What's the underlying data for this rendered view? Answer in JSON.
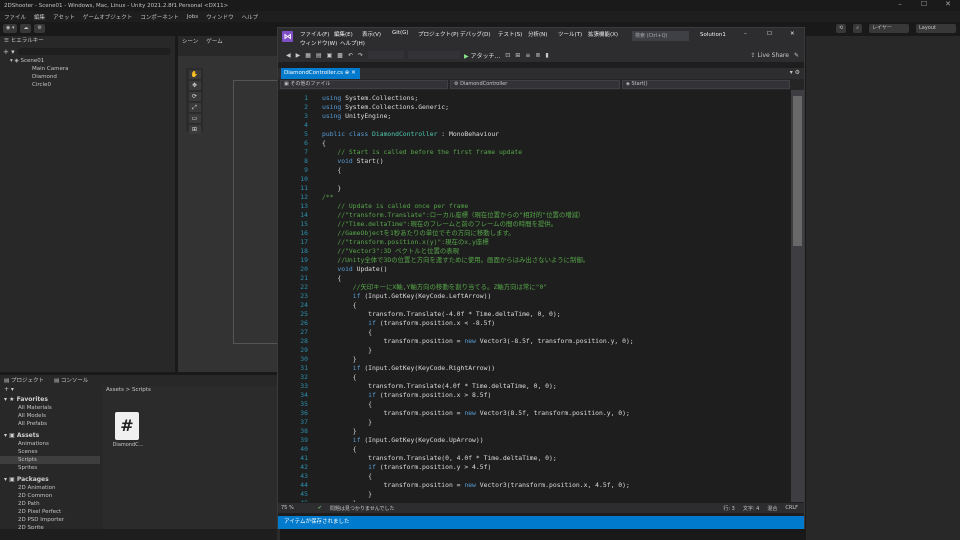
{
  "unity": {
    "title": "2DShooter - Scene01 - Windows, Mac, Linux - Unity 2021.2.8f1 Personal <DX11>",
    "menu": [
      "ファイル",
      "編集",
      "アセット",
      "ゲームオブジェクト",
      "コンポーネント",
      "Jobs",
      "ウィンドウ",
      "ヘルプ"
    ],
    "toolbar_right": [
      "レイヤー",
      "Layout"
    ],
    "hierarchy": {
      "tab": "ヒエラルキー",
      "scene": "Scene01",
      "objects": [
        "Main Camera",
        "Diamond",
        "Circle0"
      ]
    },
    "scene_tabs": [
      "シーン",
      "ゲーム"
    ],
    "project": {
      "tabs": [
        "プロジェクト",
        "コンソール"
      ],
      "favorites_title": "Favorites",
      "favorites": [
        "All Materials",
        "All Models",
        "All Prefabs"
      ],
      "assets_title": "Assets",
      "assets": [
        "Animations",
        "Scenes",
        "Scripts",
        "Sprites"
      ],
      "packages_title": "Packages",
      "packages": [
        "2D Animation",
        "2D Common",
        "2D Path",
        "2D Pixel Perfect",
        "2D PSD Importer",
        "2D Sprite"
      ],
      "breadcrumb": "Assets > Scripts",
      "file_label": "DiamondC..."
    },
    "status_message": "アイテムが保存されました"
  },
  "vs": {
    "menu": [
      "ファイル(F)",
      "編集(E)",
      "表示(V)",
      "Git(G)",
      "プロジェクト(P)",
      "デバッグ(D)",
      "テスト(S)",
      "分析(N)",
      "ツール(T)",
      "拡張機能(X)",
      "ウィンドウ(W)",
      "ヘルプ(H)"
    ],
    "search_placeholder": "検索 (Ctrl+Q)",
    "solution": "Solution1",
    "attach_label": "アタッチ...",
    "live_share": "Live Share",
    "tab_label": "DiamondController.cs",
    "nav": [
      "その他のファイル",
      "DiamondController",
      "Start()"
    ],
    "zoom": "75 %",
    "issues": "問題は見つかりませんでした",
    "line_info": "行: 3",
    "char_info": "文字: 4",
    "mode": "混合",
    "eol": "CRLF",
    "status": "アイテムが保存されました"
  },
  "code_lines": [
    {
      "n": "1",
      "t": [
        [
          "kw",
          "using "
        ],
        [
          "pl",
          "System.Collections;"
        ]
      ]
    },
    {
      "n": "2",
      "t": [
        [
          "kw",
          "using "
        ],
        [
          "pl",
          "System.Collections.Generic;"
        ]
      ]
    },
    {
      "n": "3",
      "t": [
        [
          "kw",
          "using "
        ],
        [
          "pl",
          "UnityEngine;"
        ]
      ]
    },
    {
      "n": "4",
      "t": []
    },
    {
      "n": "5",
      "t": [
        [
          "kw",
          "public class "
        ],
        [
          "ty",
          "DiamondController"
        ],
        [
          "pl",
          " : MonoBehaviour"
        ]
      ]
    },
    {
      "n": "6",
      "t": [
        [
          "pl",
          "{"
        ]
      ]
    },
    {
      "n": "7",
      "t": [
        [
          "cm",
          "    // Start is called before the first frame update"
        ]
      ]
    },
    {
      "n": "8",
      "t": [
        [
          "kw",
          "    void "
        ],
        [
          "pl",
          "Start()"
        ]
      ]
    },
    {
      "n": "9",
      "t": [
        [
          "pl",
          "    {"
        ]
      ]
    },
    {
      "n": "10",
      "t": []
    },
    {
      "n": "11",
      "t": [
        [
          "pl",
          "    }"
        ]
      ]
    },
    {
      "n": "12",
      "t": [
        [
          "cm",
          "/**"
        ]
      ]
    },
    {
      "n": "13",
      "t": [
        [
          "cm",
          "    // Update is called once per frame"
        ]
      ]
    },
    {
      "n": "14",
      "t": [
        [
          "cm",
          "    //\"transform.Translate\":ローカル座標（現在位置からの\"相対的\"位置の増減）"
        ]
      ]
    },
    {
      "n": "15",
      "t": [
        [
          "cm",
          "    //\"Time.deltaTime\":現在のフレームと前のフレームの間の時間を提供。"
        ]
      ]
    },
    {
      "n": "16",
      "t": [
        [
          "cm",
          "    //GameObjectを1秒あたりの単位でその方向に移動します。"
        ]
      ]
    },
    {
      "n": "17",
      "t": [
        [
          "cm",
          "    //\"transform.position.x(y)\":現在のx,y座標"
        ]
      ]
    },
    {
      "n": "18",
      "t": [
        [
          "cm",
          "    //\"Vector3\":3D ベクトルと位置の表現"
        ]
      ]
    },
    {
      "n": "19",
      "t": [
        [
          "cm",
          "    //Unity全体で3Dの位置と方向を渡すために使用。画面からはみ出さないように制御。"
        ]
      ]
    },
    {
      "n": "20",
      "t": [
        [
          "kw",
          "    void "
        ],
        [
          "pl",
          "Update()"
        ]
      ]
    },
    {
      "n": "21",
      "t": [
        [
          "pl",
          "    {"
        ]
      ]
    },
    {
      "n": "22",
      "t": [
        [
          "cm",
          "        //矢印キーにX軸,Y軸方向の移動を割り当てる。Z軸方向は常に\"0\""
        ]
      ]
    },
    {
      "n": "23",
      "t": [
        [
          "kw",
          "        if "
        ],
        [
          "pl",
          "(Input.GetKey(KeyCode.LeftArrow))"
        ]
      ]
    },
    {
      "n": "24",
      "t": [
        [
          "pl",
          "        {"
        ]
      ]
    },
    {
      "n": "25",
      "t": [
        [
          "pl",
          "            transform.Translate(-4.0f * Time.deltaTime, 0, 0);"
        ]
      ]
    },
    {
      "n": "26",
      "t": [
        [
          "kw",
          "            if "
        ],
        [
          "pl",
          "(transform.position.x < -8.5f)"
        ]
      ]
    },
    {
      "n": "27",
      "t": [
        [
          "pl",
          "            {"
        ]
      ]
    },
    {
      "n": "28",
      "t": [
        [
          "pl",
          "                transform.position = "
        ],
        [
          "kw",
          "new "
        ],
        [
          "pl",
          "Vector3(-8.5f, transform.position.y, 0);"
        ]
      ]
    },
    {
      "n": "29",
      "t": [
        [
          "pl",
          "            }"
        ]
      ]
    },
    {
      "n": "30",
      "t": [
        [
          "pl",
          "        }"
        ]
      ]
    },
    {
      "n": "31",
      "t": [
        [
          "kw",
          "        if "
        ],
        [
          "pl",
          "(Input.GetKey(KeyCode.RightArrow))"
        ]
      ]
    },
    {
      "n": "32",
      "t": [
        [
          "pl",
          "        {"
        ]
      ]
    },
    {
      "n": "33",
      "t": [
        [
          "pl",
          "            transform.Translate(4.0f * Time.deltaTime, 0, 0);"
        ]
      ]
    },
    {
      "n": "34",
      "t": [
        [
          "kw",
          "            if "
        ],
        [
          "pl",
          "(transform.position.x > 8.5f)"
        ]
      ]
    },
    {
      "n": "35",
      "t": [
        [
          "pl",
          "            {"
        ]
      ]
    },
    {
      "n": "36",
      "t": [
        [
          "pl",
          "                transform.position = "
        ],
        [
          "kw",
          "new "
        ],
        [
          "pl",
          "Vector3(8.5f, transform.position.y, 0);"
        ]
      ]
    },
    {
      "n": "37",
      "t": [
        [
          "pl",
          "            }"
        ]
      ]
    },
    {
      "n": "38",
      "t": [
        [
          "pl",
          "        }"
        ]
      ]
    },
    {
      "n": "39",
      "t": [
        [
          "kw",
          "        if "
        ],
        [
          "pl",
          "(Input.GetKey(KeyCode.UpArrow))"
        ]
      ]
    },
    {
      "n": "40",
      "t": [
        [
          "pl",
          "        {"
        ]
      ]
    },
    {
      "n": "41",
      "t": [
        [
          "pl",
          "            transform.Translate(0, 4.0f * Time.deltaTime, 0);"
        ]
      ]
    },
    {
      "n": "42",
      "t": [
        [
          "kw",
          "            if "
        ],
        [
          "pl",
          "(transform.position.y > 4.5f)"
        ]
      ]
    },
    {
      "n": "43",
      "t": [
        [
          "pl",
          "            {"
        ]
      ]
    },
    {
      "n": "44",
      "t": [
        [
          "pl",
          "                transform.position = "
        ],
        [
          "kw",
          "new "
        ],
        [
          "pl",
          "Vector3(transform.position.x, 4.5f, 0);"
        ]
      ]
    },
    {
      "n": "45",
      "t": [
        [
          "pl",
          "            }"
        ]
      ]
    },
    {
      "n": "46",
      "t": [
        [
          "pl",
          "        }"
        ]
      ]
    }
  ],
  "colors": {
    "vs_accent": "#007acc",
    "unity_panel": "#282828"
  }
}
